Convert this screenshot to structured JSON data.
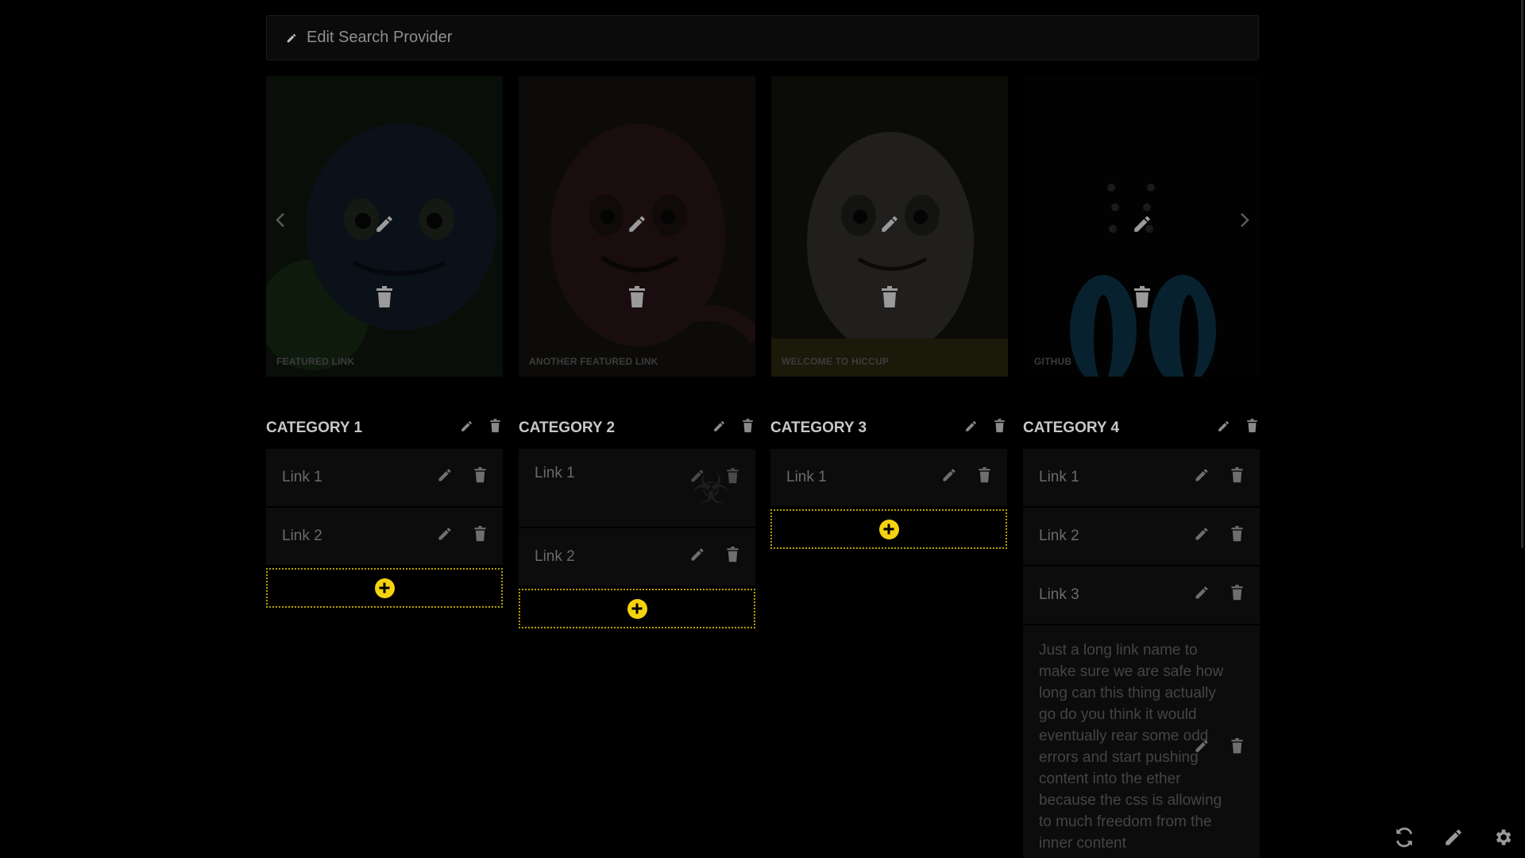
{
  "search": {
    "label": "Edit Search Provider"
  },
  "carousel": {
    "cards": [
      {
        "label": "FEATURED LINK",
        "tone": "#1b2a3a"
      },
      {
        "label": "ANOTHER FEATURED LINK",
        "tone": "#3a1f20"
      },
      {
        "label": "WELCOME TO HICCUP",
        "tone": "#3a3128"
      },
      {
        "label": "GITHUB",
        "tone": "#050607"
      }
    ]
  },
  "categories": [
    {
      "title": "CATEGORY 1",
      "links": [
        "Link 1",
        "Link 2"
      ]
    },
    {
      "title": "CATEGORY 2",
      "links": [
        "Link 1",
        "Link 2"
      ]
    },
    {
      "title": "CATEGORY 3",
      "links": [
        "Link 1"
      ]
    },
    {
      "title": "CATEGORY 4",
      "links": [
        "Link 1",
        "Link 2",
        "Link 3"
      ],
      "long_link": "Just a long link name to make sure we are safe how long can this thing actually go do you think it would eventually rear some odd errors and start pushing content into the ether because the css is allowing to much freedom from the inner content"
    }
  ],
  "colors": {
    "accent": "#f5d30f",
    "background": "#000000",
    "card": "#0c0c0c"
  },
  "toolbar": {
    "icons": [
      "refresh-icon",
      "edit-icon",
      "settings-icon"
    ]
  }
}
